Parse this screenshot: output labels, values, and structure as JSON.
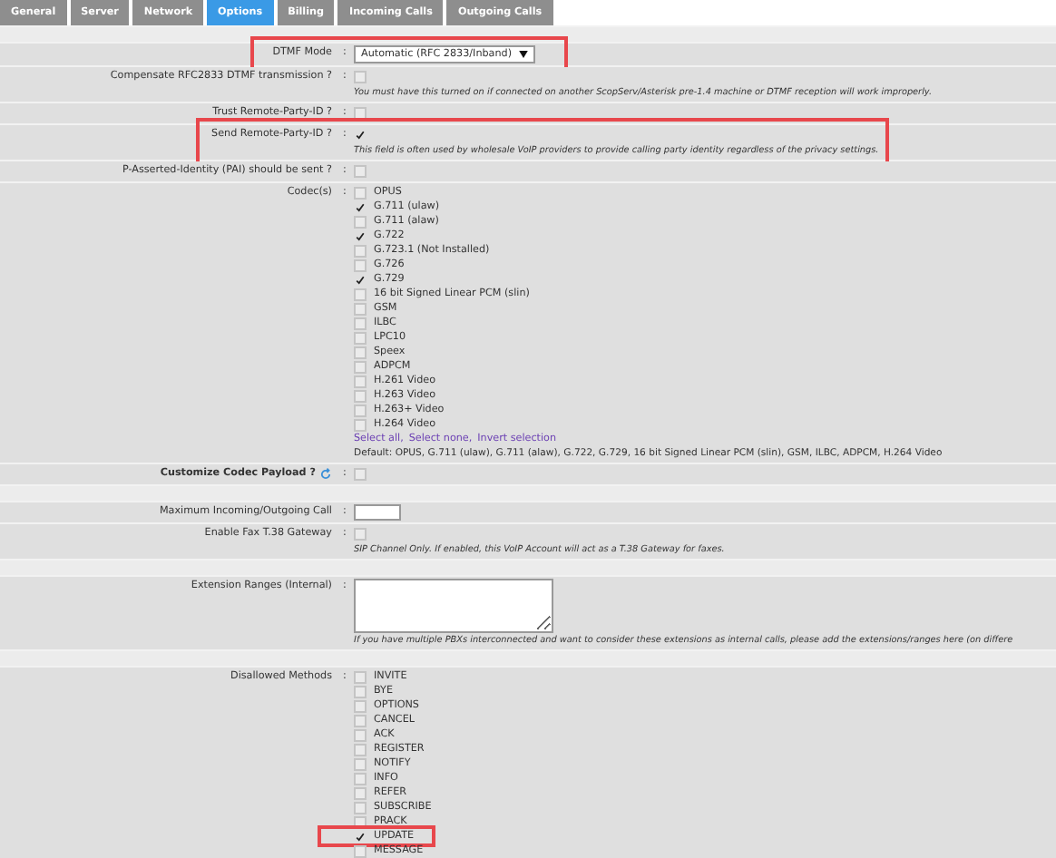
{
  "tabs": [
    {
      "label": "General",
      "selected": false
    },
    {
      "label": "Server",
      "selected": false
    },
    {
      "label": "Network",
      "selected": false
    },
    {
      "label": "Options",
      "selected": true
    },
    {
      "label": "Billing",
      "selected": false
    },
    {
      "label": "Incoming Calls",
      "selected": false
    },
    {
      "label": "Outgoing Calls",
      "selected": false
    }
  ],
  "rows": [
    {
      "kind": "spacer"
    },
    {
      "kind": "select",
      "label": "DTMF Mode",
      "colon": ":",
      "value": "Automatic (RFC 2833/Inband)",
      "highlighted": true
    },
    {
      "kind": "checkbox",
      "label": "Compensate RFC2833 DTMF transmission ?",
      "colon": ":",
      "checked": false,
      "note": "You must have this turned on if connected on another ScopServ/Asterisk pre-1.4 machine or DTMF reception will work improperly."
    },
    {
      "kind": "checkbox",
      "label": "Trust Remote-Party-ID ?",
      "colon": ":",
      "checked": false
    },
    {
      "kind": "checkbox",
      "label": "Send Remote-Party-ID ?",
      "colon": ":",
      "checked": true,
      "note": "This field is often used by wholesale VoIP providers to provide calling party identity regardless of the privacy settings.",
      "highlighted": true
    },
    {
      "kind": "checkbox",
      "label": "P-Asserted-Identity (PAI) should be sent ?",
      "colon": ":",
      "checked": false
    },
    {
      "kind": "checklist",
      "label": "Codec(s)",
      "colon": ":",
      "options": [
        {
          "label": "OPUS",
          "checked": false
        },
        {
          "label": "G.711 (ulaw)",
          "checked": true
        },
        {
          "label": "G.711 (alaw)",
          "checked": false
        },
        {
          "label": "G.722",
          "checked": true
        },
        {
          "label": "G.723.1 (Not Installed)",
          "checked": false
        },
        {
          "label": "G.726",
          "checked": false
        },
        {
          "label": "G.729",
          "checked": true
        },
        {
          "label": "16 bit Signed Linear PCM (slin)",
          "checked": false
        },
        {
          "label": "GSM",
          "checked": false
        },
        {
          "label": "ILBC",
          "checked": false
        },
        {
          "label": "LPC10",
          "checked": false
        },
        {
          "label": "Speex",
          "checked": false
        },
        {
          "label": "ADPCM",
          "checked": false
        },
        {
          "label": "H.261 Video",
          "checked": false
        },
        {
          "label": "H.263 Video",
          "checked": false
        },
        {
          "label": "H.263+ Video",
          "checked": false
        },
        {
          "label": "H.264 Video",
          "checked": false
        }
      ],
      "links": [
        "Select all,",
        "Select none,",
        "Invert selection"
      ],
      "note": "Default: OPUS, G.711 (ulaw), G.711 (alaw), G.722, G.729, 16 bit Signed Linear PCM (slin), GSM, ILBC, ADPCM, H.264 Video"
    },
    {
      "kind": "checkbox",
      "label": "Customize Codec Payload ?",
      "colon": ":",
      "bold": true,
      "refresh": true,
      "checked": false
    },
    {
      "kind": "spacer"
    },
    {
      "kind": "number",
      "label": "Maximum Incoming/Outgoing Call",
      "colon": ":"
    },
    {
      "kind": "checkbox",
      "label": "Enable Fax T.38 Gateway",
      "colon": ":",
      "checked": false,
      "note": "SIP Channel Only. If enabled, this VoIP Account will act as a T.38 Gateway for faxes."
    },
    {
      "kind": "spacer"
    },
    {
      "kind": "textarea",
      "label": "Extension Ranges (Internal)",
      "colon": ":",
      "note": "If you have multiple PBXs interconnected and want to consider these extensions as internal calls, please add the extensions/ranges here (on differe"
    },
    {
      "kind": "spacer"
    },
    {
      "kind": "checklist",
      "label": "Disallowed Methods",
      "colon": ":",
      "options": [
        {
          "label": "INVITE",
          "checked": false
        },
        {
          "label": "BYE",
          "checked": false
        },
        {
          "label": "OPTIONS",
          "checked": false
        },
        {
          "label": "CANCEL",
          "checked": false
        },
        {
          "label": "ACK",
          "checked": false
        },
        {
          "label": "REGISTER",
          "checked": false
        },
        {
          "label": "NOTIFY",
          "checked": false
        },
        {
          "label": "INFO",
          "checked": false
        },
        {
          "label": "REFER",
          "checked": false
        },
        {
          "label": "SUBSCRIBE",
          "checked": false
        },
        {
          "label": "PRACK",
          "checked": false
        },
        {
          "label": "UPDATE",
          "checked": true,
          "highlighted": true
        },
        {
          "label": "MESSAGE",
          "checked": false
        }
      ]
    }
  ]
}
